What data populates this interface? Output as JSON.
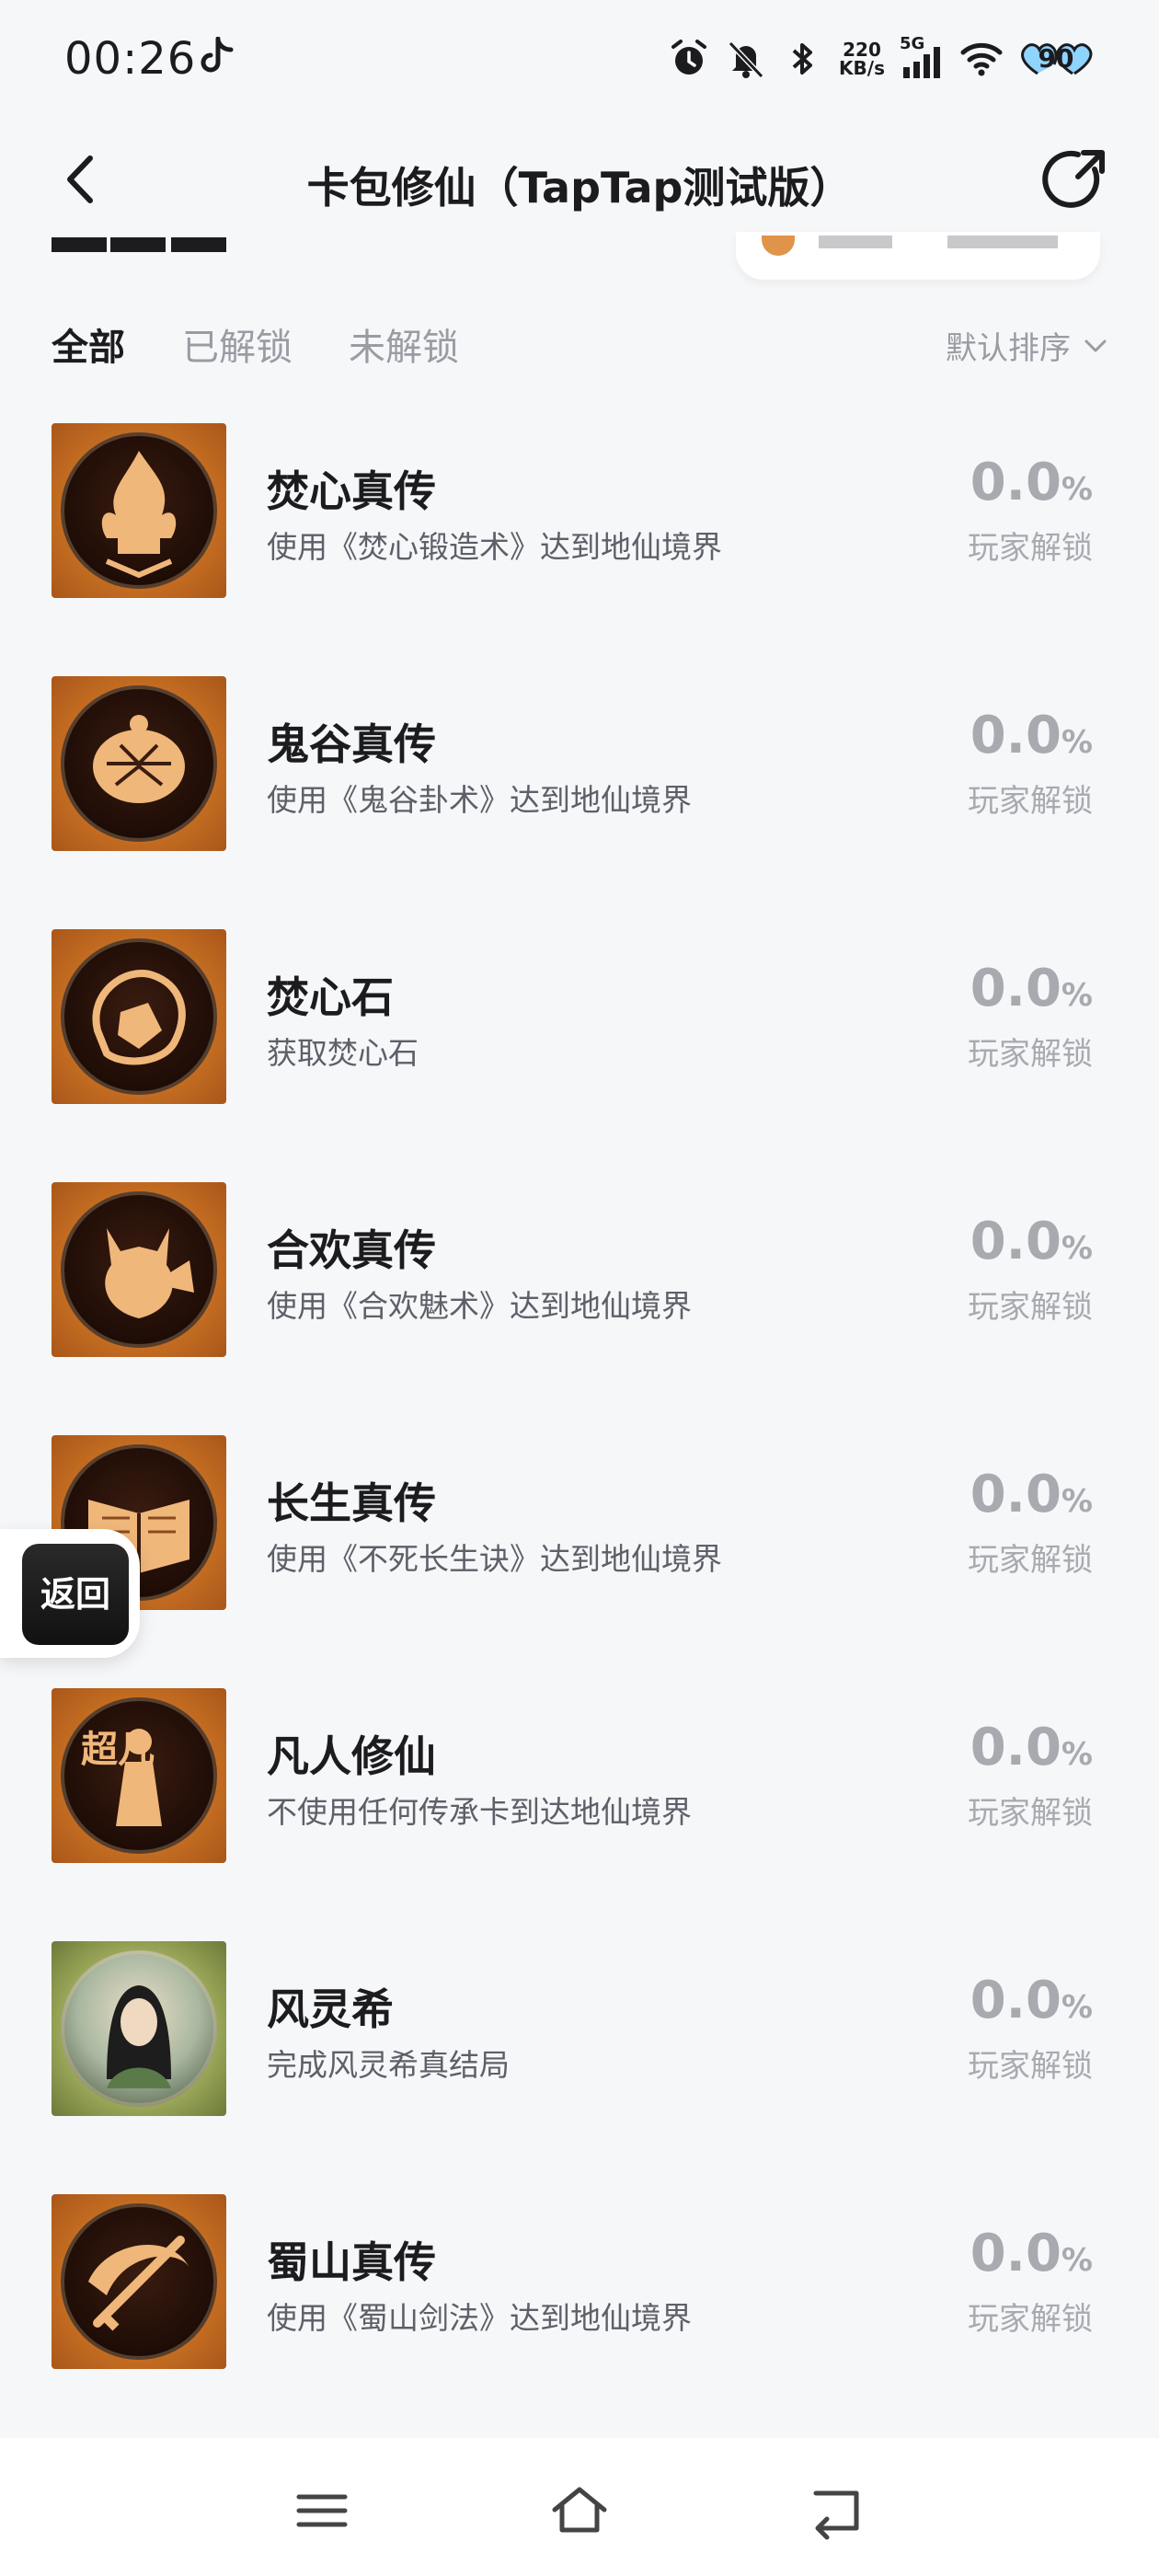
{
  "status_bar": {
    "time": "00:26",
    "net_speed_value": "220",
    "net_speed_unit": "KB/s",
    "network": "5G",
    "battery": "90"
  },
  "header": {
    "title": "卡包修仙（TapTap测试版）"
  },
  "filters": {
    "tabs": [
      "全部",
      "已解锁",
      "未解锁"
    ],
    "active_tab": "全部",
    "sort_label": "默认排序"
  },
  "achievements": [
    {
      "name": "焚心真传",
      "desc": "使用《焚心锻造术》达到地仙境界",
      "rate": "0.0",
      "unit": "%",
      "label": "玩家解锁",
      "icon": "flame-forge-icon"
    },
    {
      "name": "鬼谷真传",
      "desc": "使用《鬼谷卦术》达到地仙境界",
      "rate": "0.0",
      "unit": "%",
      "label": "玩家解锁",
      "icon": "turtle-shell-icon"
    },
    {
      "name": "焚心石",
      "desc": "获取焚心石",
      "rate": "0.0",
      "unit": "%",
      "label": "玩家解锁",
      "icon": "fire-stone-icon"
    },
    {
      "name": "合欢真传",
      "desc": "使用《合欢魅术》达到地仙境界",
      "rate": "0.0",
      "unit": "%",
      "label": "玩家解锁",
      "icon": "fox-fan-icon"
    },
    {
      "name": "长生真传",
      "desc": "使用《不死长生诀》达到地仙境界",
      "rate": "0.0",
      "unit": "%",
      "label": "玩家解锁",
      "icon": "open-book-icon"
    },
    {
      "name": "凡人修仙",
      "desc": "不使用任何传承卡到达地仙境界",
      "rate": "0.0",
      "unit": "%",
      "label": "玩家解锁",
      "icon": "chaofan-figure-icon",
      "icon_text": "超凡"
    },
    {
      "name": "风灵希",
      "desc": "完成风灵希真结局",
      "rate": "0.0",
      "unit": "%",
      "label": "玩家解锁",
      "icon": "portrait-icon"
    },
    {
      "name": "蜀山真传",
      "desc": "使用《蜀山剑法》达到地仙境界",
      "rate": "0.0",
      "unit": "%",
      "label": "玩家解锁",
      "icon": "sword-icon"
    }
  ],
  "floating": {
    "return_label": "返回"
  },
  "colors": {
    "background": "#f6f7f9",
    "muted": "#a8aab0",
    "badge_bronze": "#c56e22"
  }
}
